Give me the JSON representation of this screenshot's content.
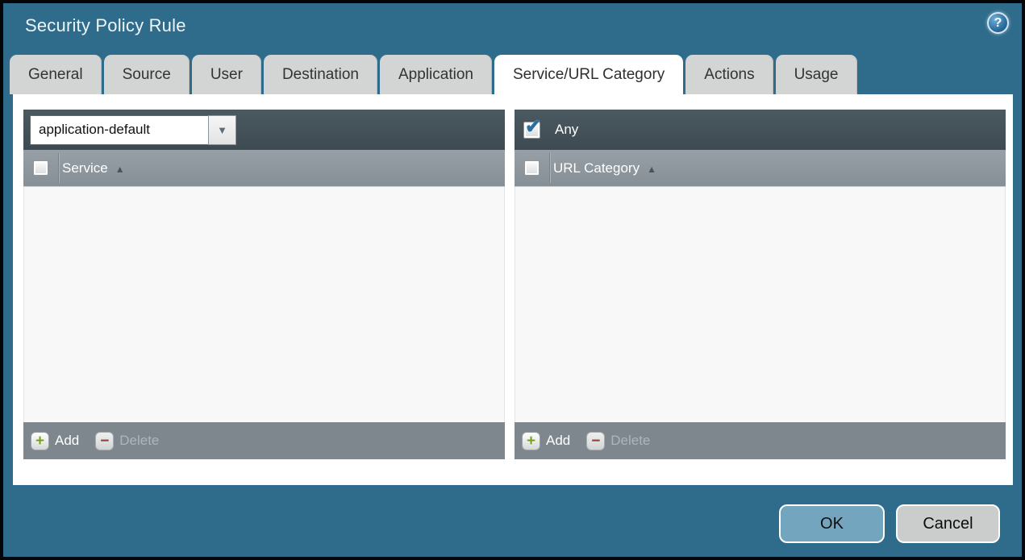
{
  "dialog": {
    "title": "Security Policy Rule"
  },
  "icons": {
    "help": "?",
    "dropdown_arrow": "▼",
    "sort_asc": "▲",
    "add": "+",
    "delete": "−",
    "check": "✔"
  },
  "tabs": [
    {
      "label": "General",
      "active": false
    },
    {
      "label": "Source",
      "active": false
    },
    {
      "label": "User",
      "active": false
    },
    {
      "label": "Destination",
      "active": false
    },
    {
      "label": "Application",
      "active": false
    },
    {
      "label": "Service/URL Category",
      "active": true
    },
    {
      "label": "Actions",
      "active": false
    },
    {
      "label": "Usage",
      "active": false
    }
  ],
  "service_panel": {
    "dropdown_value": "application-default",
    "column_header": "Service",
    "rows": [],
    "add_label": "Add",
    "delete_label": "Delete",
    "delete_enabled": false
  },
  "url_category_panel": {
    "any_label": "Any",
    "any_checked": true,
    "column_header": "URL Category",
    "rows": [],
    "add_label": "Add",
    "delete_label": "Delete",
    "delete_enabled": false
  },
  "actions": {
    "ok_label": "OK",
    "cancel_label": "Cancel"
  },
  "colors": {
    "background": "#2f6c8c",
    "dark_bar": "#414e56",
    "header_bar": "#8e979d",
    "footer_bar": "#7e878d",
    "ok_button": "#74a5bf",
    "cancel_button": "#cbcccc",
    "check_blue": "#2b6f9e",
    "add_green": "#7aa11d",
    "delete_red": "#943d3d"
  }
}
